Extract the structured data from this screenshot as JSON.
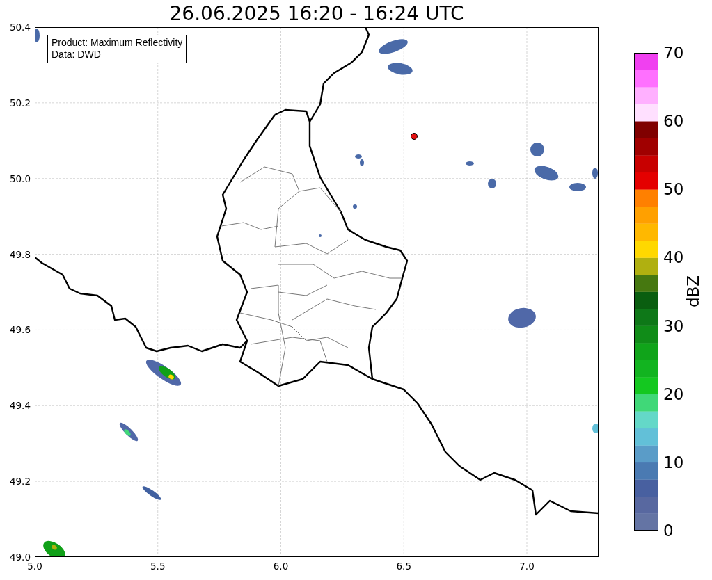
{
  "title": "26.06.2025 16:20 - 16:24 UTC",
  "legend": [
    "Product: Maximum Reflectivity",
    "Data: DWD"
  ],
  "x_ticks": [
    "5.0",
    "5.5",
    "6.0",
    "6.5",
    "7.0"
  ],
  "y_ticks": [
    "50.4",
    "50.2",
    "50.0",
    "49.8",
    "49.6",
    "49.4",
    "49.2",
    "49.0"
  ],
  "colorbar": {
    "label": "dBZ",
    "ticks": [
      "70",
      "60",
      "50",
      "40",
      "30",
      "20",
      "10",
      "0"
    ],
    "segments": [
      {
        "color": "#6474a4"
      },
      {
        "color": "#5868a0"
      },
      {
        "color": "#4860a0"
      },
      {
        "color": "#4a7ab2"
      },
      {
        "color": "#5a9cc8"
      },
      {
        "color": "#62c0d8"
      },
      {
        "color": "#64d8c8"
      },
      {
        "color": "#40d878"
      },
      {
        "color": "#14c820"
      },
      {
        "color": "#12b420"
      },
      {
        "color": "#10a41a"
      },
      {
        "color": "#108c18"
      },
      {
        "color": "#0e7818"
      },
      {
        "color": "#0a5e10"
      },
      {
        "color": "#467810"
      },
      {
        "color": "#b0b010"
      },
      {
        "color": "#ffd800"
      },
      {
        "color": "#ffb800"
      },
      {
        "color": "#ffa000"
      },
      {
        "color": "#ff8000"
      },
      {
        "color": "#e40000"
      },
      {
        "color": "#c80000"
      },
      {
        "color": "#a00000"
      },
      {
        "color": "#800000"
      },
      {
        "color": "#ffe0ff"
      },
      {
        "color": "#ffb0ff"
      },
      {
        "color": "#ff70ff"
      },
      {
        "color": "#f040f0"
      }
    ]
  }
}
